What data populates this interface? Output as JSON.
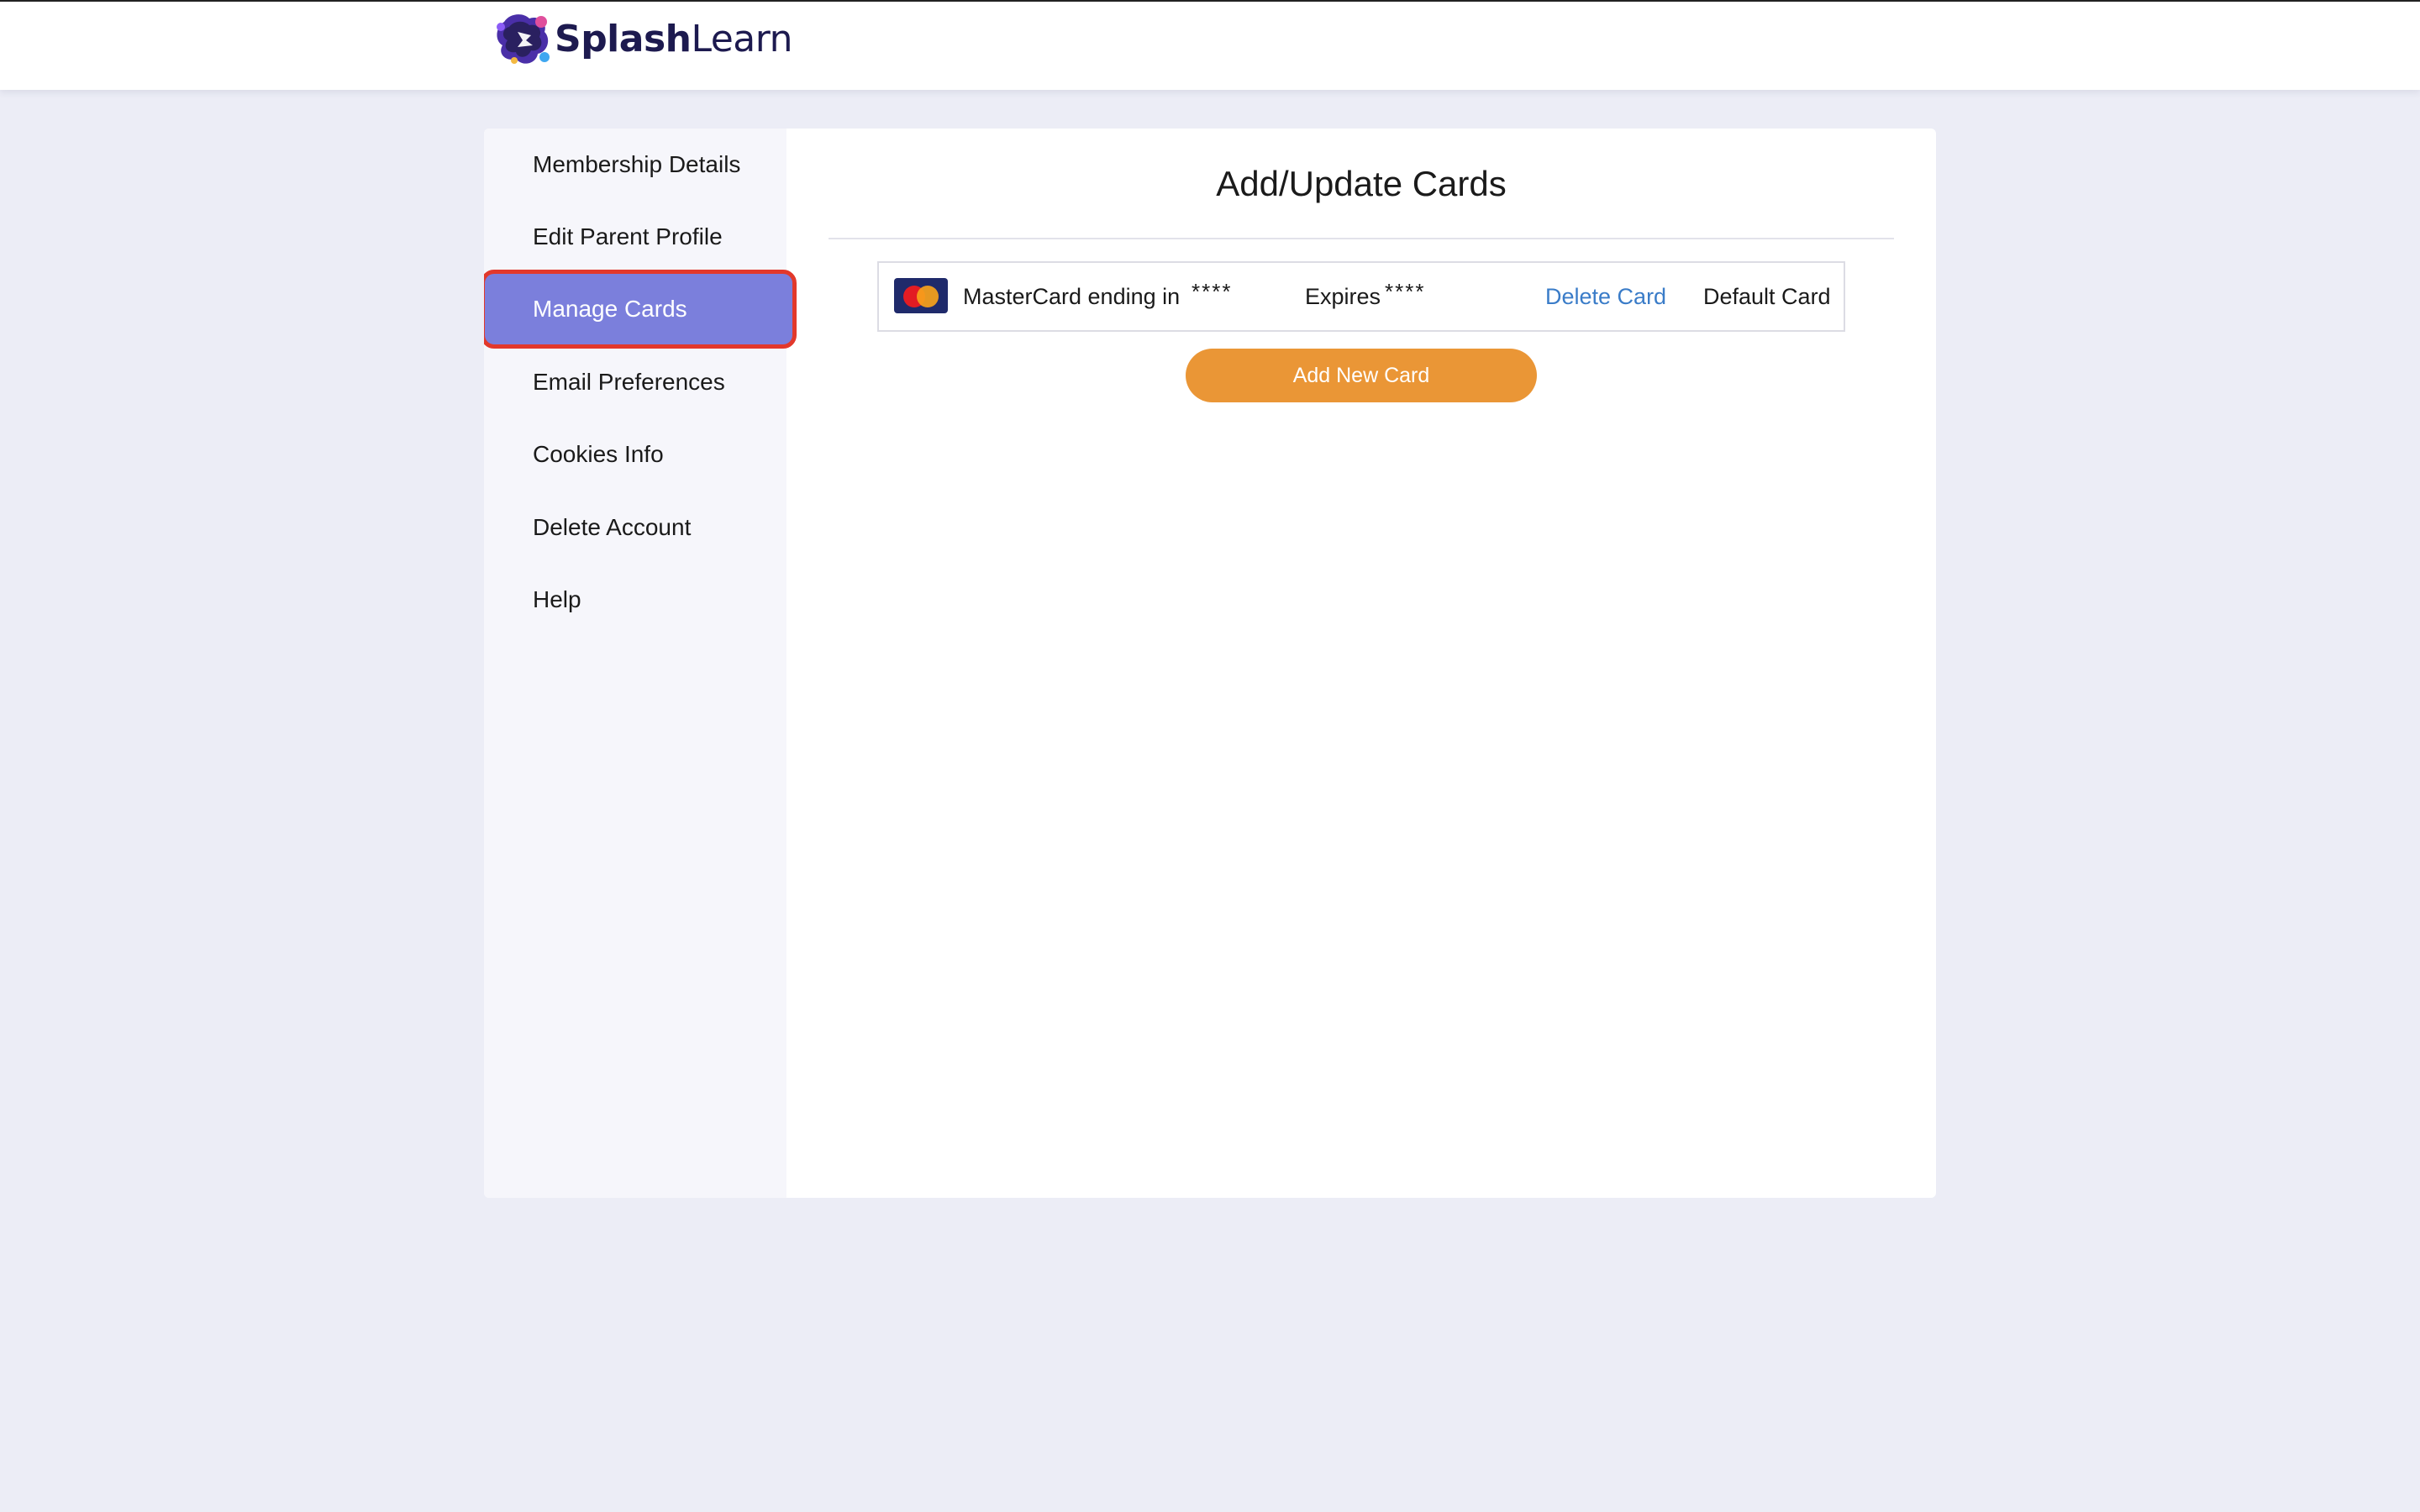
{
  "brand": {
    "name_bold": "Splash",
    "name_light": "Learn",
    "logo_icon": "splashlearn-logo-icon",
    "text_color": "#1d1a4f"
  },
  "sidebar": {
    "items": [
      {
        "label": "Membership Details",
        "active": false
      },
      {
        "label": "Edit Parent Profile",
        "active": false
      },
      {
        "label": "Manage Cards",
        "active": true
      },
      {
        "label": "Email Preferences",
        "active": false
      },
      {
        "label": "Cookies Info",
        "active": false
      },
      {
        "label": "Delete Account",
        "active": false
      },
      {
        "label": "Help",
        "active": false
      }
    ],
    "active_color": "#7b7fdc",
    "highlight_border_color": "#e2382b"
  },
  "main": {
    "title": "Add/Update Cards",
    "card": {
      "brand_icon": "mastercard-icon",
      "label": "MasterCard ending in",
      "number_mask": "****",
      "expires_label": "Expires",
      "expires_mask": "****",
      "delete_label": "Delete Card",
      "default_label": "Default Card"
    },
    "add_button_label": "Add New Card",
    "add_button_color": "#ea9636",
    "link_color": "#3a7cc8"
  }
}
